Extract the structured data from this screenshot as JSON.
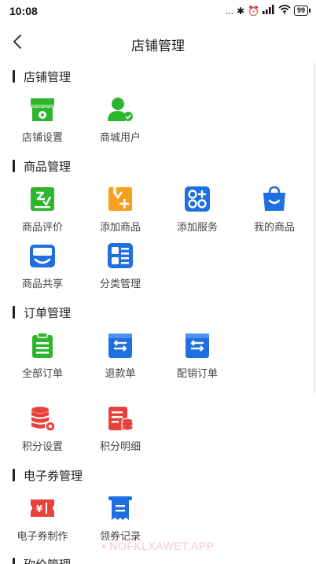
{
  "status_bar": {
    "time": "10:08",
    "signal_text": "...",
    "battery": "99"
  },
  "nav": {
    "title": "店铺管理"
  },
  "sections": {
    "store": {
      "title": "店铺管理",
      "items": [
        {
          "label": "店铺设置",
          "icon": "store-settings-icon",
          "color": "#2db52d"
        },
        {
          "label": "商城用户",
          "icon": "mall-users-icon",
          "color": "#2db52d"
        }
      ]
    },
    "goods": {
      "title": "商品管理",
      "items": [
        {
          "label": "商品评价",
          "icon": "product-review-icon",
          "color": "#2db52d"
        },
        {
          "label": "添加商品",
          "icon": "add-product-icon",
          "color": "#f5a020"
        },
        {
          "label": "添加服务",
          "icon": "add-service-icon",
          "color": "#1f6fe0"
        },
        {
          "label": "我的商品",
          "icon": "my-products-icon",
          "color": "#1f6fe0"
        },
        {
          "label": "商品共享",
          "icon": "product-share-icon",
          "color": "#1f6fe0"
        },
        {
          "label": "分类管理",
          "icon": "category-icon",
          "color": "#1f6fe0"
        }
      ]
    },
    "orders": {
      "title": "订单管理",
      "items": [
        {
          "label": "全部订单",
          "icon": "all-orders-icon",
          "color": "#2db52d"
        },
        {
          "label": "退款单",
          "icon": "refund-order-icon",
          "color": "#1f6fe0"
        },
        {
          "label": "配销订单",
          "icon": "distribution-order-icon",
          "color": "#1f6fe0"
        }
      ]
    },
    "points": {
      "items": [
        {
          "label": "积分设置",
          "icon": "points-settings-icon",
          "color": "#e8413c"
        },
        {
          "label": "积分明细",
          "icon": "points-detail-icon",
          "color": "#e8413c"
        }
      ]
    },
    "coupon": {
      "title": "电子券管理",
      "items": [
        {
          "label": "电子券制作",
          "icon": "coupon-create-icon",
          "color": "#e8413c"
        },
        {
          "label": "领券记录",
          "icon": "coupon-record-icon",
          "color": "#1f6fe0"
        }
      ]
    },
    "next": {
      "title": "砍价管理"
    }
  },
  "watermark": "• NOFKLXAWET.APP"
}
